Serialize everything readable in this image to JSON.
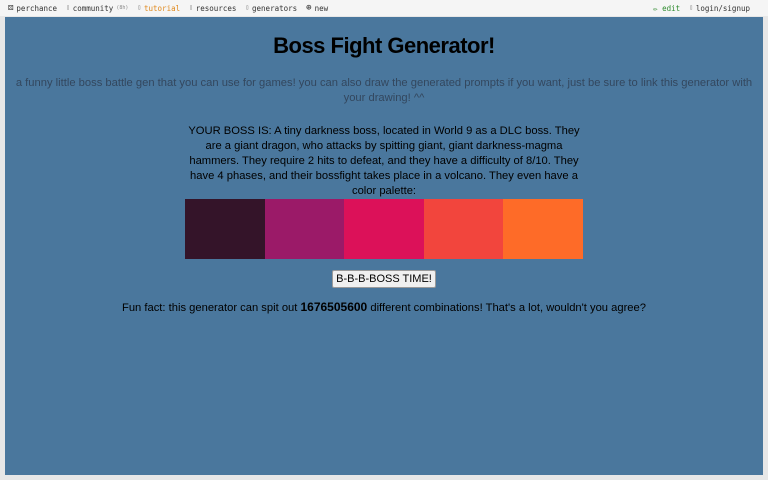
{
  "nav": {
    "brand_label": "perchance",
    "community_label": "community",
    "community_badge": "(8h)",
    "tutorial_label": "tutorial",
    "resources_label": "resources",
    "generators_label": "generators",
    "new_label": "new",
    "edit_label": "✏ edit",
    "login_label": "login/signup"
  },
  "page": {
    "title": "Boss Fight Generator!",
    "subtitle": "a funny little boss battle gen that you can use for games! you can also draw the generated prompts if you want, just be sure to link this generator with your drawing! ^^",
    "boss_description": "YOUR BOSS IS: A tiny darkness boss, located in World 9 as a DLC boss. They are a giant dragon, who attacks by spitting giant, giant darkness-magma hammers. They require 2 hits to defeat, and they have a difficulty of 8/10. They have 4 phases, and their bossfight takes place in a volcano. They even have a color palette:",
    "button_label": "B-B-B-BOSS TIME!",
    "fun_fact_prefix": "Fun fact: this generator can spit out ",
    "fun_fact_count": "1676505600",
    "fun_fact_suffix": " different combinations! That's a lot, wouldn't you agree?"
  },
  "palette": {
    "colors": [
      "#341429",
      "#9b1a68",
      "#dc1159",
      "#f2453d",
      "#fe6b28"
    ]
  },
  "colors": {
    "panel_bg": "#4a779d",
    "tutorial_accent": "#e08a1e",
    "edit_accent": "#2e8b2e"
  }
}
